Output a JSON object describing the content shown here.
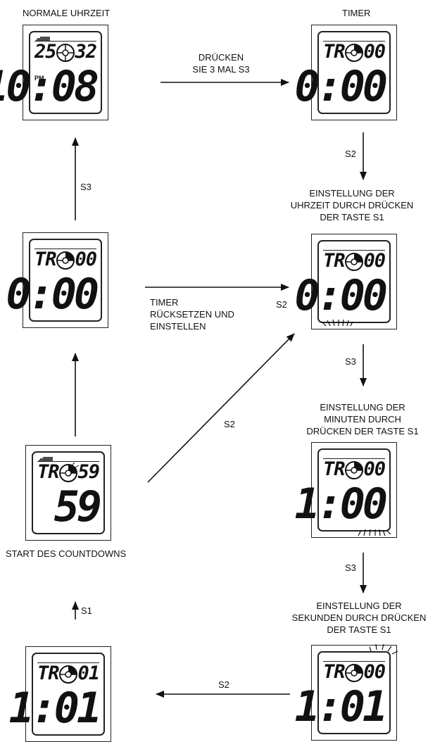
{
  "labels": {
    "normal_time": "NORMALE UHRZEIT",
    "timer": "TIMER",
    "press_three": "DRÜCKEN\nSIE 3 MAL S3",
    "s2_a": "S2",
    "set_hours": "EINSTELLUNG DER\nUHRZEIT DURCH DRÜCKEN\nDER TASTE S1",
    "s3_left": "S3",
    "reset_timer": "TIMER\nRÜCKSETZEN UND\nEINSTELLEN",
    "s2_b": "S2",
    "s3_b": "S3",
    "set_minutes": "EINSTELLUNG DER\nMINUTEN DURCH\nDRÜCKEN DER TASTE S1",
    "s2_diag": "S2",
    "countdown_start": "START DES COUNTDOWNS",
    "s3_c": "S3",
    "set_seconds": "EINSTELLUNG DER\nSEKUNDEN DURCH DRÜCKEN\nDER TASTE S1",
    "s1": "S1",
    "s2_bottom": "S2"
  },
  "displays": {
    "normal": {
      "top_left": "25",
      "top_right": "32",
      "main": "10:08",
      "pm": "PM"
    },
    "timer": {
      "top_left": "TR",
      "top_right": "00",
      "main": "0:00"
    },
    "reset": {
      "top_left": "TR",
      "top_right": "00",
      "main": "0:00"
    },
    "set_hours": {
      "top_left": "TR",
      "top_right": "00",
      "main": "0:00"
    },
    "countdown": {
      "top_left": "TR",
      "top_right": "59",
      "main": "59"
    },
    "set_minutes": {
      "top_left": "TR",
      "top_right": "00",
      "main": "1:00"
    },
    "s1_state": {
      "top_left": "TR",
      "top_right": "01",
      "main": "1:01"
    },
    "set_seconds": {
      "top_left": "TR",
      "top_right": "00",
      "main": "1:01"
    }
  }
}
